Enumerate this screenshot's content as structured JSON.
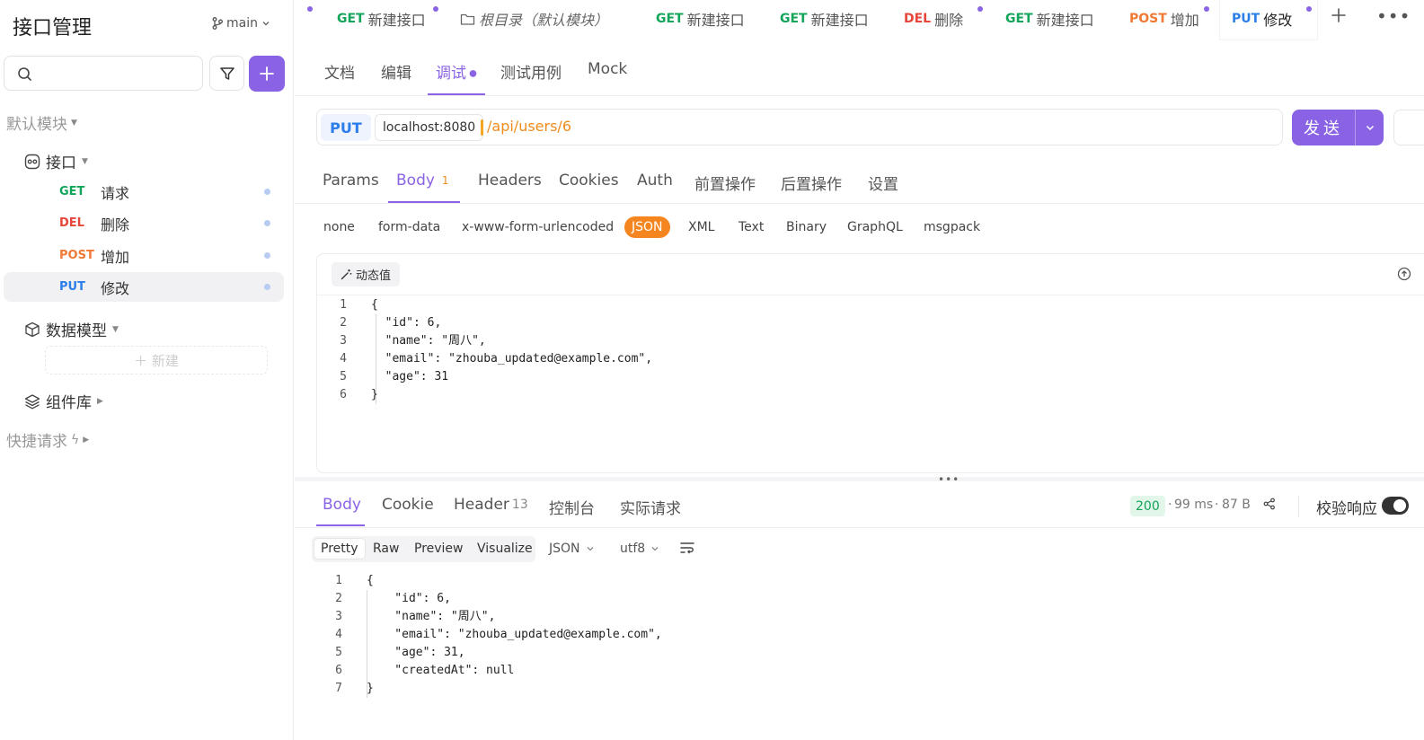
{
  "sidebar": {
    "title": "接口管理",
    "branch": "main",
    "search_placeholder": "",
    "default_module": "默认模块",
    "api_group": "接口",
    "apis": [
      {
        "method": "GET",
        "name": "请求"
      },
      {
        "method": "DEL",
        "name": "删除"
      },
      {
        "method": "POST",
        "name": "增加"
      },
      {
        "method": "PUT",
        "name": "修改"
      }
    ],
    "data_model": "数据模型",
    "new_label": "新建",
    "components": "组件库",
    "quick_request": "快捷请求"
  },
  "top_tabs": [
    {
      "method": "GET",
      "name": "新建接口"
    },
    {
      "method": "",
      "name": "根目录（默认模块）"
    },
    {
      "method": "GET",
      "name": "新建接口"
    },
    {
      "method": "GET",
      "name": "新建接口"
    },
    {
      "method": "DEL",
      "name": "删除"
    },
    {
      "method": "GET",
      "name": "新建接口"
    },
    {
      "method": "POST",
      "name": "增加"
    },
    {
      "method": "PUT",
      "name": "修改"
    }
  ],
  "section_tabs": [
    "文档",
    "编辑",
    "调试",
    "测试用例",
    "Mock"
  ],
  "url": {
    "method": "PUT",
    "host": "localhost:8080",
    "path": "/api/users/6",
    "send_label": "发送"
  },
  "request_tabs": [
    {
      "label": "Params",
      "badge": ""
    },
    {
      "label": "Body",
      "badge": "1"
    },
    {
      "label": "Headers",
      "badge": ""
    },
    {
      "label": "Cookies",
      "badge": ""
    },
    {
      "label": "Auth",
      "badge": ""
    },
    {
      "label": "前置操作",
      "badge": ""
    },
    {
      "label": "后置操作",
      "badge": ""
    },
    {
      "label": "设置",
      "badge": ""
    }
  ],
  "body_types": [
    "none",
    "form-data",
    "x-www-form-urlencoded",
    "JSON",
    "XML",
    "Text",
    "Binary",
    "GraphQL",
    "msgpack"
  ],
  "editor": {
    "dynamic_label": "动态值",
    "request_lines": [
      "{",
      "  \"id\": 6,",
      "  \"name\": \"周八\",",
      "  \"email\": \"zhouba_updated@example.com\",",
      "  \"age\": 31",
      "}"
    ]
  },
  "response": {
    "tabs": [
      {
        "label": "Body",
        "badge": ""
      },
      {
        "label": "Cookie",
        "badge": ""
      },
      {
        "label": "Header",
        "badge": "13"
      },
      {
        "label": "控制台",
        "badge": ""
      },
      {
        "label": "实际请求",
        "badge": ""
      }
    ],
    "status": "200",
    "time": "99 ms",
    "size": "87 B",
    "verify_label": "校验响应",
    "view_tabs": [
      "Pretty",
      "Raw",
      "Preview",
      "Visualize"
    ],
    "format": "JSON",
    "encoding": "utf8",
    "lines": [
      "{",
      "    \"id\": 6,",
      "    \"name\": \"周八\",",
      "    \"email\": \"zhouba_updated@example.com\",",
      "    \"age\": 31,",
      "    \"createdAt\": null",
      "}"
    ]
  },
  "colors": {
    "accent": "#8a63e5",
    "get": "#12a55a",
    "del": "#e6453a",
    "post": "#f07a35",
    "put": "#2b7de9",
    "json_active": "#f5861f"
  }
}
